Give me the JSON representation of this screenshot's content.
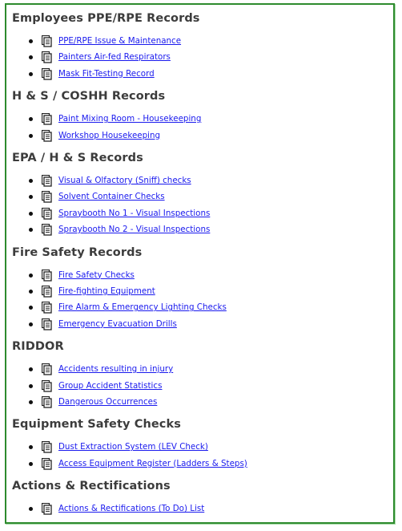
{
  "colors": {
    "border": "#2e8b2e",
    "heading": "#3c3c3c",
    "link": "#1a1aee"
  },
  "icons": {
    "item_icon": "document-list-icon",
    "bullet": "bullet-dot"
  },
  "sections": [
    {
      "title": "Employees PPE/RPE Records",
      "items": [
        {
          "label": "PPE/RPE Issue & Maintenance"
        },
        {
          "label": "Painters Air-fed Respirators"
        },
        {
          "label": "Mask Fit-Testing Record"
        }
      ]
    },
    {
      "title": "H & S / COSHH Records",
      "items": [
        {
          "label": "Paint Mixing Room - Housekeeping"
        },
        {
          "label": "Workshop Housekeeping"
        }
      ]
    },
    {
      "title": "EPA / H & S Records",
      "items": [
        {
          "label": "Visual & Olfactory (Sniff) checks"
        },
        {
          "label": "Solvent Container Checks"
        },
        {
          "label": "Spraybooth No 1 - Visual Inspections"
        },
        {
          "label": "Spraybooth No 2 - Visual Inspections"
        }
      ]
    },
    {
      "title": "Fire Safety Records",
      "items": [
        {
          "label": "Fire Safety Checks"
        },
        {
          "label": "Fire-fighting Equipment"
        },
        {
          "label": "Fire Alarm & Emergency Lighting Checks"
        },
        {
          "label": "Emergency Evacuation Drills"
        }
      ]
    },
    {
      "title": "RIDDOR",
      "items": [
        {
          "label": "Accidents resulting in injury"
        },
        {
          "label": "Group Accident Statistics"
        },
        {
          "label": "Dangerous Occurrences"
        }
      ]
    },
    {
      "title": "Equipment Safety Checks",
      "items": [
        {
          "label": "Dust Extraction System (LEV Check)"
        },
        {
          "label": "Access Equipment Register (Ladders & Steps)"
        }
      ]
    },
    {
      "title": "Actions & Rectifications",
      "items": [
        {
          "label": "Actions & Rectifications (To Do) List"
        }
      ]
    }
  ]
}
